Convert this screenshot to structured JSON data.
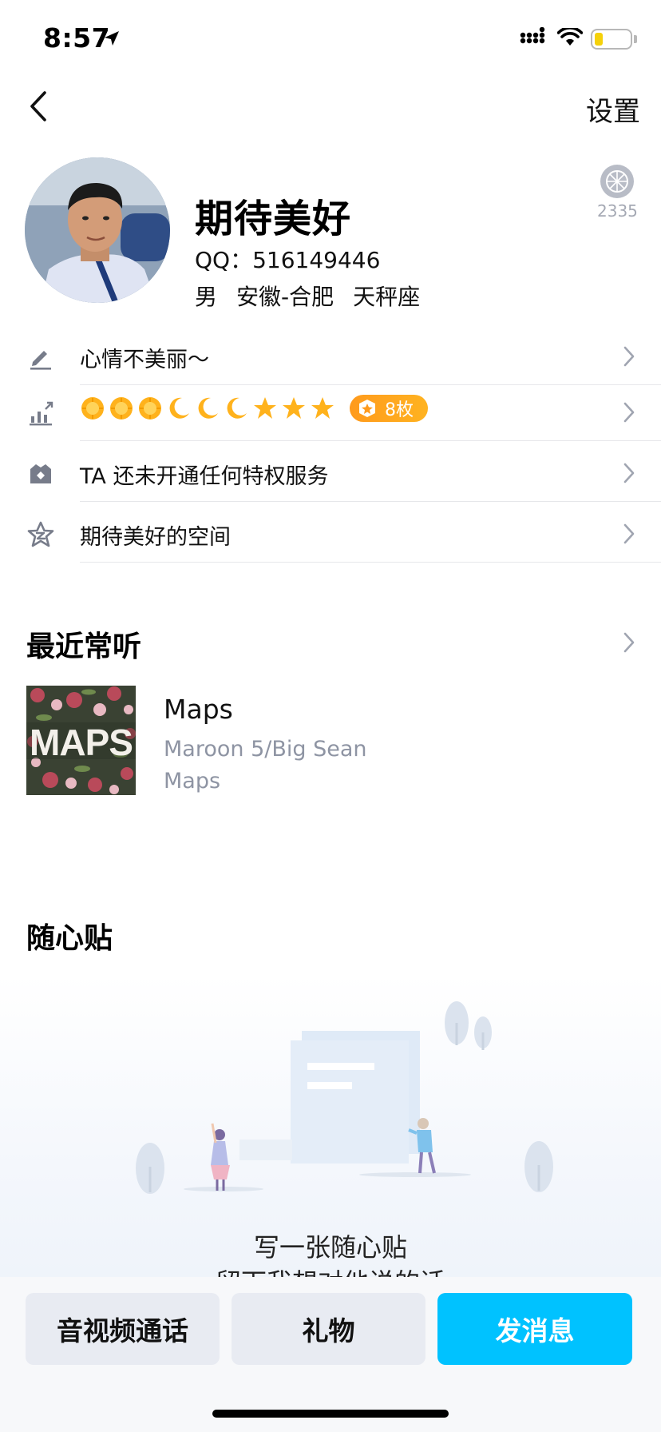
{
  "status_bar": {
    "time": "8:57",
    "battery_color": "#f5d10a"
  },
  "nav": {
    "settings_label": "设置"
  },
  "profile": {
    "nickname": "期待美好",
    "qq": "QQ：516149446",
    "gender": "男",
    "location": "安徽-合肥",
    "zodiac": "天秤座",
    "like_count": "2335"
  },
  "rows": [
    {
      "icon": "pencil-icon",
      "text": "心情不美丽～"
    },
    {
      "icon": "level-chart-icon",
      "badges": [
        "sun",
        "sun",
        "sun",
        "moon",
        "moon",
        "moon",
        "star",
        "star",
        "star"
      ],
      "medal_text": "8枚"
    },
    {
      "icon": "vip-crown-icon",
      "text": "TA 还未开通任何特权服务"
    },
    {
      "icon": "qzone-star-icon",
      "text": "期待美好的空间"
    }
  ],
  "music": {
    "section_title": "最近常听",
    "song_title": "Maps",
    "artist": "Maroon 5/Big Sean",
    "album": "Maps",
    "album_art_text": "MAPS"
  },
  "sticky": {
    "section_title": "随心贴",
    "empty_line1": "写一张随心贴",
    "empty_line2": "留下我想对他说的话"
  },
  "actions": {
    "call_label": "音视频通话",
    "gift_label": "礼物",
    "message_label": "发消息"
  },
  "colors": {
    "accent": "#00c2ff",
    "medal": "#ff9a1c",
    "secondary_text": "#8e94a3"
  }
}
